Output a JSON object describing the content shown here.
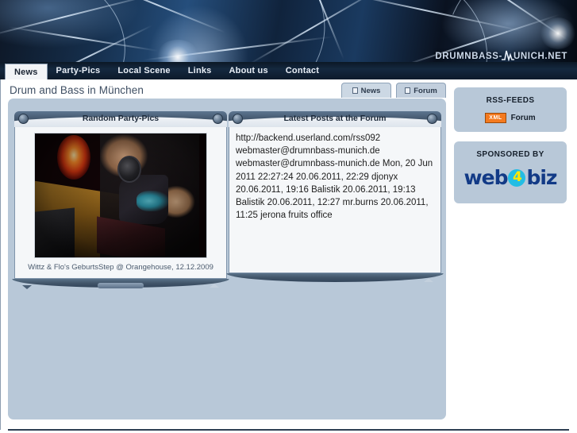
{
  "site": {
    "logo_text_left": "DRUMNBASS-",
    "logo_text_right": "UNICH.NET",
    "logo_icon": "waveform-icon"
  },
  "nav": {
    "items": [
      {
        "label": "News",
        "active": true
      },
      {
        "label": "Party-Pics",
        "active": false
      },
      {
        "label": "Local Scene",
        "active": false
      },
      {
        "label": "Links",
        "active": false
      },
      {
        "label": "About us",
        "active": false
      },
      {
        "label": "Contact",
        "active": false
      }
    ]
  },
  "header": {
    "page_title": "Drum and Bass in München"
  },
  "tabs": [
    {
      "label": "News",
      "icon": "page-icon",
      "active": true
    },
    {
      "label": "Forum",
      "icon": "page-icon",
      "active": false
    }
  ],
  "pics_panel": {
    "title": "Random Party-Pics",
    "caption": "Wittz & Flo's GeburtsStep @ Orangehouse, 12.12.2009",
    "image_alt": "dj-party-photo"
  },
  "forum_panel": {
    "title": "Latest Posts at the Forum",
    "body": "http://backend.userland.com/rss092 webmaster@drumnbass-munich.de webmaster@drumnbass-munich.de Mon, 20 Jun 2011 22:27:24 20.06.2011, 22:29 djonyx 20.06.2011, 19:16 Balistik 20.06.2011, 19:13 Balistik 20.06.2011, 12:27 mr.burns 20.06.2011, 11:25 jerona fruits office"
  },
  "sidebar": {
    "rss": {
      "heading": "RSS-FEEDS",
      "badge": "XML",
      "link_label": "Forum"
    },
    "sponsor": {
      "heading": "SPONSORED BY",
      "logo_part1": "web",
      "logo_part2": "4",
      "logo_part3": "biz"
    }
  },
  "colors": {
    "content_bg": "#b8c8d8",
    "nav_bg": "#0d1b2b",
    "panel_head": "#44586e",
    "xml_orange": "#f47a1f",
    "logo_blue": "#123a86",
    "logo_circle": "#22bde4",
    "logo_four": "#ffe800"
  }
}
